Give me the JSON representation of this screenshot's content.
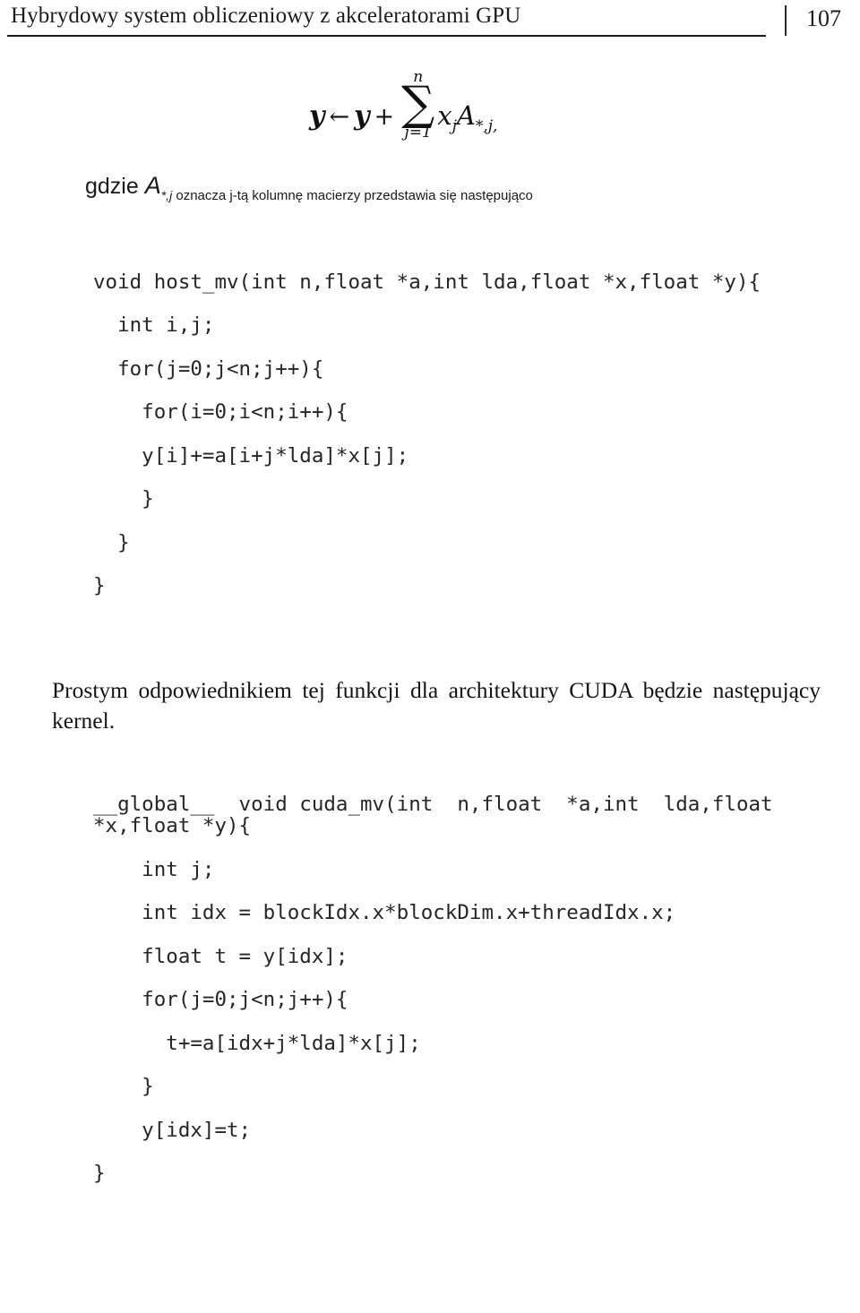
{
  "header": {
    "title": "Hybrydowy system obliczeniowy z akceleratorami GPU",
    "page_number": "107"
  },
  "formula": {
    "lhs": "y",
    "arrow": "←",
    "rhs_first": "y",
    "plus": "+",
    "sum_glyph": "∑",
    "sum_upper": "n",
    "sum_lower": "j=1",
    "term_x": "x",
    "term_x_sub": "j",
    "term_A": "A",
    "term_A_sub": "*,j,"
  },
  "gdzie": {
    "lead": "gdzie ",
    "symbol": "A",
    "subscript": "*,j",
    "rest": " oznacza j-tą kolumnę macierzy przedstawia się następująco"
  },
  "code_host": {
    "lines": [
      "void host_mv(int n,float *a,int lda,float *x,float *y){",
      "  int i,j;",
      "  for(j=0;j<n;j++){",
      "    for(i=0;i<n;i++){",
      "    y[i]+=a[i+j*lda]*x[j];",
      "    }",
      "  }",
      "}"
    ]
  },
  "paragraph": {
    "text": "Prostym odpowiednikiem tej funkcji dla architektury CUDA będzie następujący kernel."
  },
  "code_kernel": {
    "lines": [
      "__global__  void cuda_mv(int  n,float  *a,int  lda,float",
      "*x,float *y){",
      "",
      "    int j;",
      "    int idx = blockIdx.x*blockDim.x+threadIdx.x;",
      "    float t = y[idx];",
      "",
      "    for(j=0;j<n;j++){",
      "      t+=a[idx+j*lda]*x[j];",
      "    }",
      "    y[idx]=t;",
      "}"
    ]
  }
}
